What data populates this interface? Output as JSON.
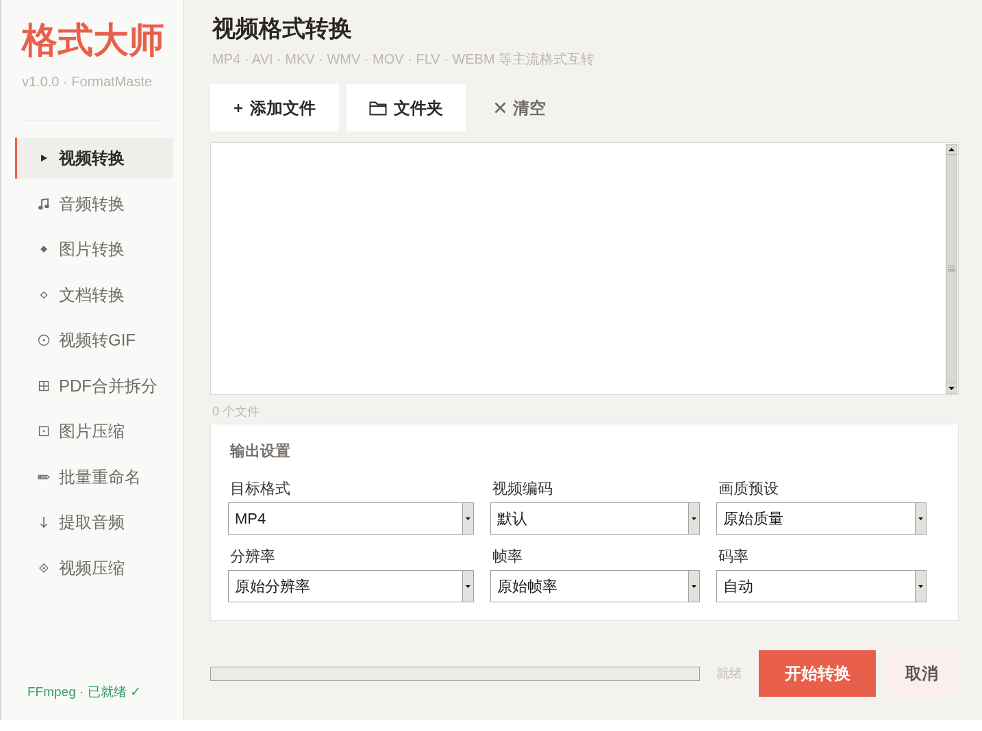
{
  "sidebar": {
    "logo": "格式大师",
    "version": "v1.0.0 · FormatMaste",
    "nav_items": [
      {
        "label": "视频转换",
        "selected": true
      },
      {
        "label": "音频转换",
        "selected": false
      },
      {
        "label": "图片转换",
        "selected": false
      },
      {
        "label": "文档转换",
        "selected": false
      },
      {
        "label": "视频转GIF",
        "selected": false
      },
      {
        "label": "PDF合并拆分",
        "selected": false
      },
      {
        "label": "图片压缩",
        "selected": false
      },
      {
        "label": "批量重命名",
        "selected": false
      },
      {
        "label": "提取音频",
        "selected": false
      },
      {
        "label": "视频压缩",
        "selected": false
      }
    ],
    "status": "FFmpeg · 已就绪 ✓"
  },
  "header": {
    "title": "视频格式转换",
    "subtitle": "MP4 · AVI · MKV · WMV · MOV · FLV · WEBM 等主流格式互转"
  },
  "toolbar": [
    {
      "kind": "add",
      "label": "添加文件"
    },
    {
      "kind": "folder",
      "label": "文件夹"
    },
    {
      "kind": "clear",
      "label": "清空"
    }
  ],
  "file_list": {
    "count": "0 个文件"
  },
  "output_settings": {
    "title": "输出设置",
    "fields": [
      {
        "label": "目标格式",
        "value": "MP4"
      },
      {
        "label": "视频编码",
        "value": "默认"
      },
      {
        "label": "画质预设",
        "value": "原始质量"
      },
      {
        "label": "分辨率",
        "value": "原始分辨率"
      },
      {
        "label": "帧率",
        "value": "原始帧率"
      },
      {
        "label": "码率",
        "value": "自动"
      }
    ]
  },
  "progress": {
    "level": 0,
    "status": "就绪"
  },
  "buttons": [
    {
      "kind": "primary",
      "label": "开始转换"
    },
    {
      "kind": "secondary",
      "label": "取消"
    }
  ]
}
